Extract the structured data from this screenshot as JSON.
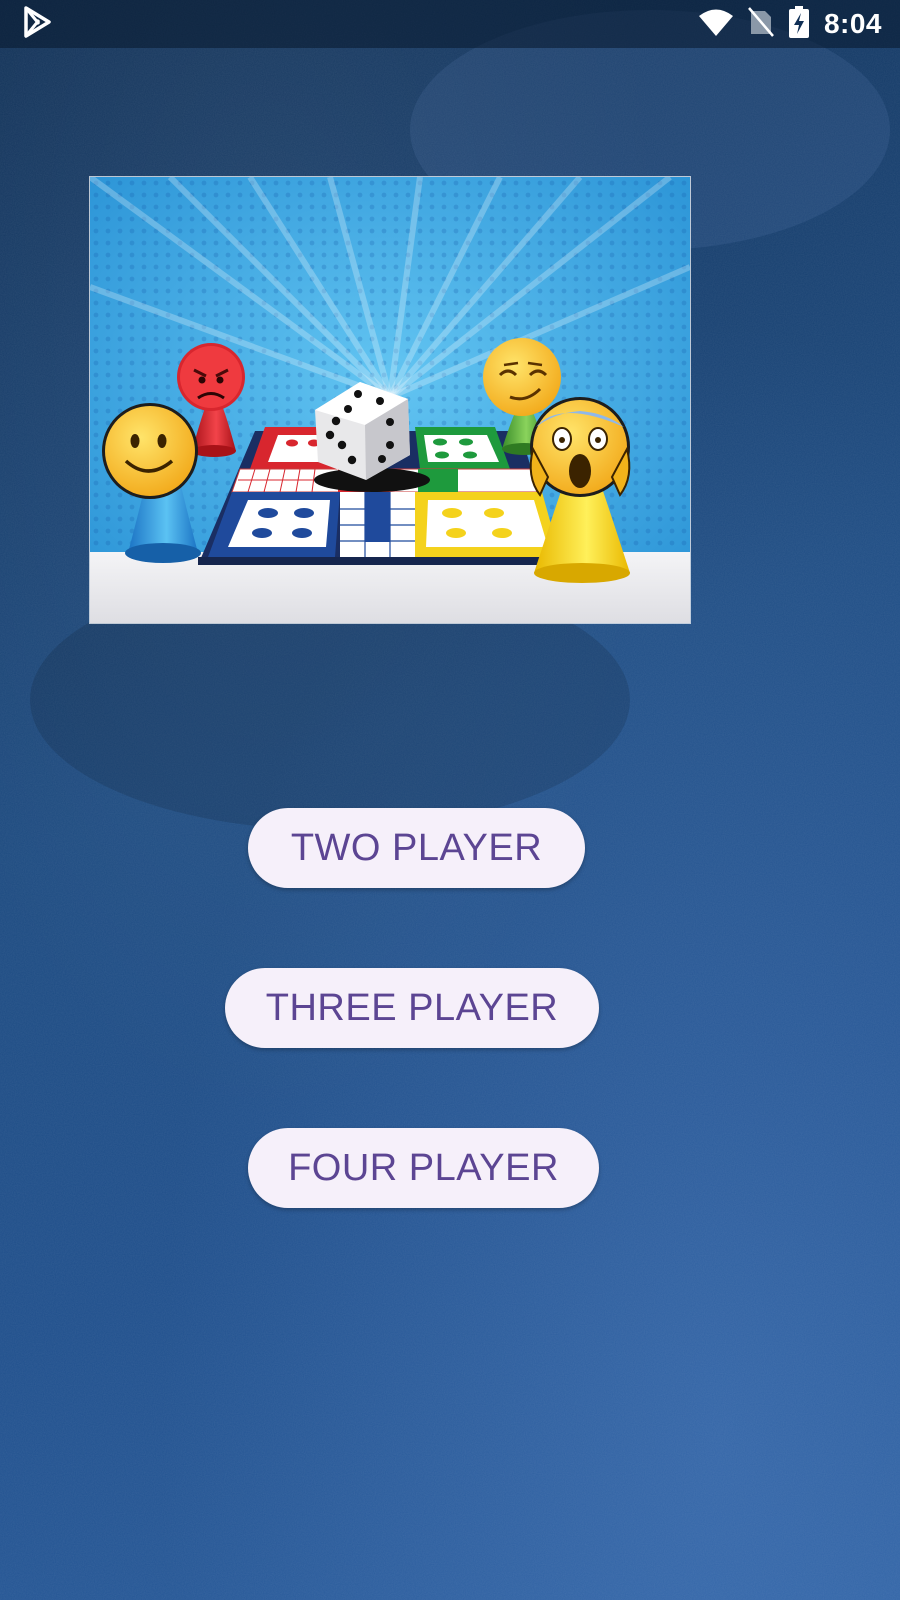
{
  "status_bar": {
    "time": "8:04",
    "icons": [
      "play-store-icon",
      "wifi-icon",
      "no-sim-icon",
      "battery-charging-icon"
    ]
  },
  "banner": {
    "image": "ludo-board-illustration",
    "pieces": [
      "smiling-face",
      "angry-face",
      "smirking-face",
      "screaming-face"
    ]
  },
  "menu": {
    "two_player_label": "TWO PLAYER",
    "three_player_label": "THREE PLAYER",
    "four_player_label": "FOUR PLAYER"
  },
  "colors": {
    "background": "#1c4a80",
    "button_bg": "#f6f0fa",
    "button_text": "#5c4593",
    "sky": "#3aa6e3",
    "red": "#d8262e",
    "green": "#1e9a3d",
    "blue": "#1f4a9c",
    "yellow": "#f4d21c"
  }
}
